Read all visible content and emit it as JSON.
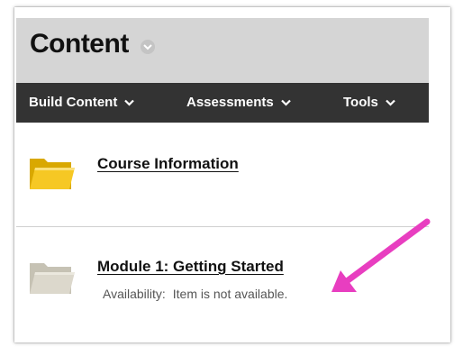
{
  "page": {
    "title": "Content"
  },
  "menu": {
    "items": [
      {
        "label": "Build Content"
      },
      {
        "label": "Assessments"
      },
      {
        "label": "Tools"
      }
    ]
  },
  "content": {
    "items": [
      {
        "title": "Course Information",
        "icon": "folder-icon",
        "available": true
      },
      {
        "title": "Module 1: Getting Started",
        "icon": "folder-icon",
        "available": false,
        "availability_label": "Availability:",
        "availability_value": "Item is not available."
      }
    ]
  },
  "annotation": {
    "icon": "arrow-icon",
    "color": "#e83ec0"
  },
  "colors": {
    "title_bar": "#d5d5d5",
    "menu_bar": "#333333",
    "folder_available": "#f3c318",
    "folder_unavailable": "#d8d4c8"
  }
}
